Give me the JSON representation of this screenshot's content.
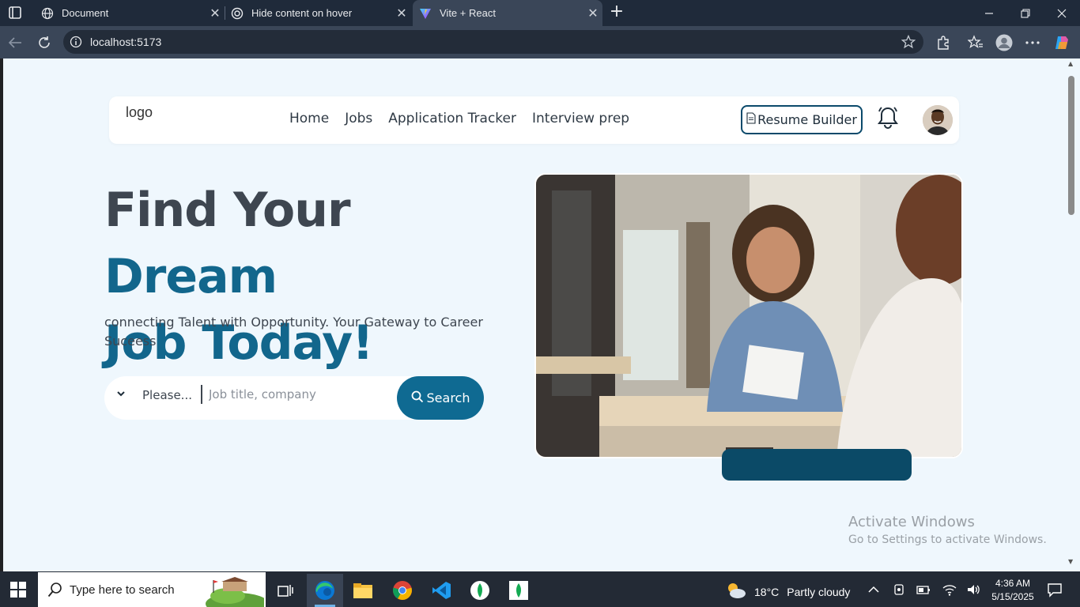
{
  "browser": {
    "tabs": [
      {
        "title": "Document",
        "icon": "globe-icon",
        "active": false
      },
      {
        "title": "Hide content on hover",
        "icon": "chatgpt-icon",
        "active": false
      },
      {
        "title": "Vite + React",
        "icon": "vite-icon",
        "active": true
      }
    ],
    "url": "localhost:5173"
  },
  "page": {
    "navbar": {
      "logo_alt": "logo",
      "links": [
        "Home",
        "Jobs",
        "Application Tracker",
        "Interview prep"
      ],
      "resume_button": "Resume Builder"
    },
    "hero": {
      "title_part1": "Find Your ",
      "title_accent1": "Dream",
      "title_accent2": "Job Today!",
      "subtitle": "connecting Talent with Opportunity. Your Gateway to Career Suceess",
      "search": {
        "category": "Please...",
        "placeholder": "Job title, company",
        "button": "Search"
      }
    },
    "colors": {
      "accent": "#12668c",
      "button": "#0f6a92",
      "badge": "#0b4a67",
      "background": "#eff7fd"
    }
  },
  "watermark": {
    "line1": "Activate Windows",
    "line2": "Go to Settings to activate Windows."
  },
  "taskbar": {
    "search_placeholder": "Type here to search",
    "weather": {
      "temp": "18°C",
      "condition": "Partly cloudy"
    },
    "time": "4:36 AM",
    "date": "5/15/2025",
    "apps": [
      "task-view-icon",
      "edge-icon",
      "file-explorer-icon",
      "chrome-icon",
      "vscode-icon",
      "mongodb-compass-icon",
      "mongodb-icon"
    ]
  }
}
